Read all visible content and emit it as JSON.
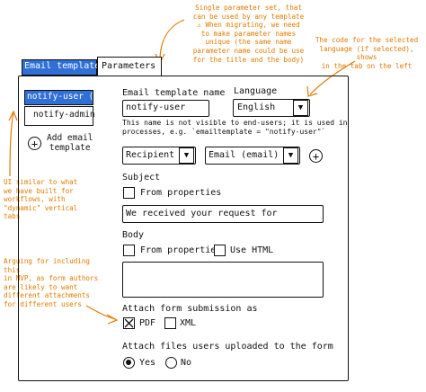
{
  "notes": {
    "single_param_set": "Single parameter set, that\ncan be used by any template\n⚠ When migrating, we need\nto make parameter names\nunique (the same name\nparameter name could be use\nfor the title and the body)",
    "language_code": "The code for the selected\nlanguage (if selected), shows\nin the tab on the left",
    "vertical_tabs": "UI similar to what\nwe have built for\nworkflows, with\n\"dynamic\" vertical tabs",
    "attachments": "Arguing for including this\nin MVP, as form authors\nare likely to want\ndifferent attachments\nfor different users"
  },
  "tabs": [
    {
      "label": "Email templates",
      "active": true
    },
    {
      "label": "Parameters",
      "active": false
    }
  ],
  "vertical_tabs": [
    {
      "label": "notify-user (en)",
      "selected": true
    },
    {
      "label": "notify-admin",
      "selected": false
    }
  ],
  "add_template_label": "Add email\ntemplate",
  "form": {
    "template_name_label": "Email template name",
    "template_name_value": "notify-user",
    "template_name_help": "This name is not visible to end-users; it is used in\nprocesses, e.g. `emailtemplate = \"notify-user\"`",
    "language_label": "Language",
    "language_value": "English",
    "recipient_type_value": "Recipient",
    "recipient_value": "Email (email)",
    "subject_label": "Subject",
    "subject_from_properties_label": "From properties",
    "subject_value": "We received your request for",
    "body_label": "Body",
    "body_from_properties_label": "From properties",
    "body_use_html_label": "Use HTML",
    "body_value": "",
    "attach_submission_label": "Attach form submission as",
    "attach_pdf_label": "PDF",
    "attach_pdf_checked": true,
    "attach_xml_label": "XML",
    "attach_xml_checked": false,
    "attach_uploads_label": "Attach files users uploaded to the form",
    "uploads_yes_label": "Yes",
    "uploads_no_label": "No",
    "uploads_selected": "Yes"
  },
  "colors": {
    "annotation": "#e07b00",
    "selection": "#2f6fd6",
    "ink": "#111111"
  }
}
